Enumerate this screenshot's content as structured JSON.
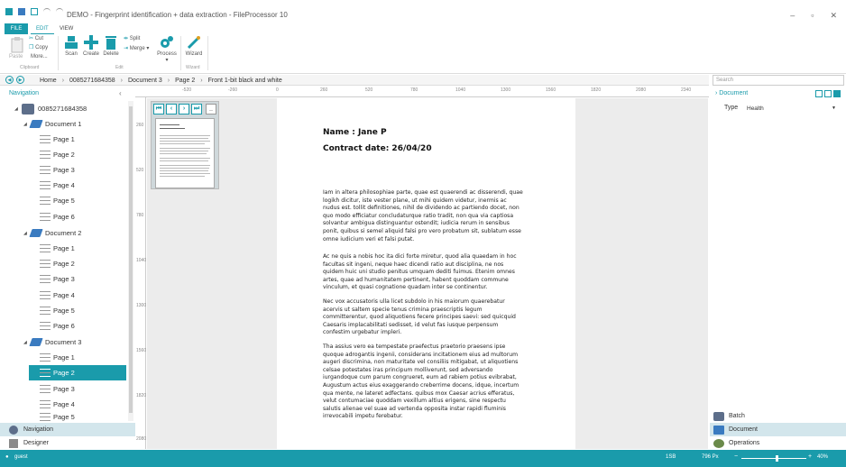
{
  "titlebar": {
    "title": "DEMO - Fingerprint identification + data extraction - FileProcessor 10",
    "minimize": "–",
    "restore": "▫",
    "close": "✕"
  },
  "ribbon": {
    "tabs": [
      "FILE",
      "EDIT",
      "VIEW"
    ],
    "clipboard": {
      "paste": "Paste",
      "cut": "Cut",
      "copy": "Copy",
      "more": "More...",
      "group": "Clipboard"
    },
    "edit": {
      "scan": "Scan",
      "create": "Create",
      "delete": "Delete",
      "split": "Split",
      "merge": "Merge",
      "process": "Process",
      "group": "Edit"
    },
    "wizard": {
      "wizard": "Wizard",
      "group": "Wizard"
    }
  },
  "breadcrumb": [
    "Home",
    "0085271684358",
    "Document 3",
    "Page 2",
    "Front 1-bit black and white"
  ],
  "search": {
    "placeholder": "Search"
  },
  "navigation": {
    "title": "Navigation",
    "batch": "0085271684358",
    "documents": [
      {
        "name": "Document 1",
        "pages": [
          "Page 1",
          "Page 2",
          "Page 3",
          "Page 4",
          "Page 5",
          "Page 6"
        ]
      },
      {
        "name": "Document 2",
        "pages": [
          "Page 1",
          "Page 2",
          "Page 3",
          "Page 4",
          "Page 5",
          "Page 6"
        ]
      },
      {
        "name": "Document 3",
        "pages": [
          "Page 1",
          "Page 2",
          "Page 3",
          "Page 4",
          "Page 5"
        ]
      }
    ],
    "selected": "Document 3 / Page 2",
    "bottom": [
      "Navigation",
      "Designer"
    ]
  },
  "rulers": {
    "h": [
      "-520",
      "-260",
      "0",
      "260",
      "520",
      "780",
      "1040",
      "1300",
      "1560",
      "1820",
      "2080",
      "2340"
    ],
    "v": [
      "260",
      "520",
      "780",
      "1040",
      "1300",
      "1560",
      "1820",
      "2080"
    ]
  },
  "thumb_nav": [
    "⏮",
    "‹",
    "›",
    "⏭",
    "_"
  ],
  "document": {
    "name_line": "Name : Jane P",
    "contract_line": "Contract date: 26/04/20",
    "paragraphs": [
      "Iam in altera philosophiae parte, quae est quaerendi ac disserendi, quae logikh dicitur, iste vester plane, ut mihi quidem videtur, inermis ac nudus est. tollit definitiones, nihil de dividendo ac partiendo docet, non quo modo efficiatur concludaturque ratio tradit, non qua via captiosa solvantur ambigua distinguantur ostendit; iudicia rerum in sensibus ponit, quibus si semel aliquid falsi pro vero probatum sit, sublatum esse omne iudicium veri et falsi putat.",
      "Ac ne quis a nobis hoc ita dici forte miretur, quod alia quaedam in hoc facultas sit ingeni, neque haec dicendi ratio aut disciplina, ne nos quidem huic uni studio penitus umquam dediti fuimus. Etenim omnes artes, quae ad humanitatem pertinent, habent quoddam commune vinculum, et quasi cognatione quadam inter se continentur.",
      "Nec vox accusatoris ulla licet subdolo in his maiorum quaerebatur acervis ut saltem specie tenus crimina praescriptis legum committerentur, quod aliquotiens fecere principes saevi: sed quicquid Caesaris implacabilitati sedisset, id velut fas iusque perpensum confestim urgebatur impleri.",
      "Tha assius vero ea tempestate praefectus praetorio praesens ipse quoque adrogantis ingenii, considerans incitationem eius ad multorum augeri discrimina, non maturitate vel consiliis mitigabat, ut aliquotiens celsae potestates iras principum molliverunt, sed adversando iurgandoque cum parum congrueret, eum ad rabiem potius evibrabat, Augustum actus eius exaggerando creberrime docens, idque, incertum qua mente, ne lateret adfectans. quibus mox Caesar acrius efferatus, velut contumaciae quoddam vexillum altius erigens, sine respectu salutis alienae vel suae ad vertenda opposita instar rapidi fluminis irrevocabili impetu ferebatur."
    ]
  },
  "properties": {
    "title": "Document",
    "type_label": "Type",
    "type_value": "Health",
    "bottom": [
      "Batch",
      "Document",
      "Operations"
    ]
  },
  "status": {
    "user": "guest",
    "page_info": "1SB",
    "dims": "796 Px",
    "zoom": "40%",
    "zoom_level": 0.4
  },
  "colors": {
    "accent": "#1a9bab",
    "selected_light": "#d3e6ec"
  }
}
